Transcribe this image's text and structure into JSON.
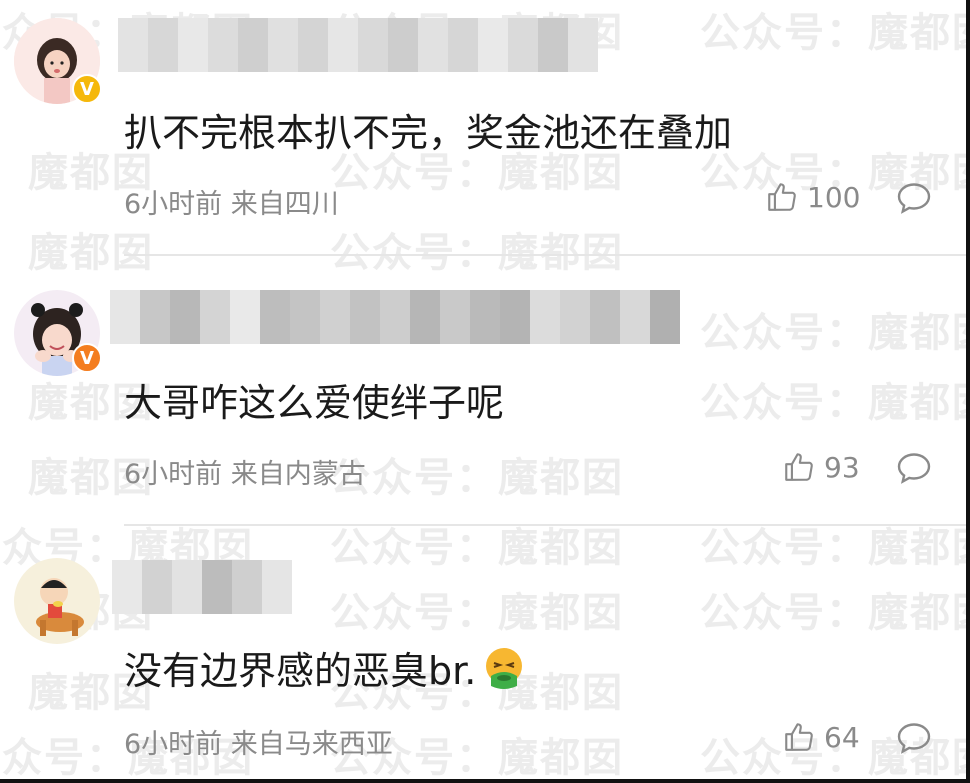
{
  "comments": [
    {
      "text": "扒不完根本扒不完，奖金池还在叠加",
      "time": "6小时前",
      "location": "来自四川",
      "likes": "100",
      "badge_color": "#f5b80b"
    },
    {
      "text": "大哥咋这么爱使绊子呢",
      "time": "6小时前",
      "location": "来自内蒙古",
      "likes": "93",
      "badge_color": "#f47d1f"
    },
    {
      "text": "没有边界感的恶臭br.",
      "time": "6小时前",
      "location": "来自马来西亚",
      "likes": "64",
      "emoji": "nauseated-face-icon"
    }
  ],
  "watermark": "公众号：魔都囡"
}
